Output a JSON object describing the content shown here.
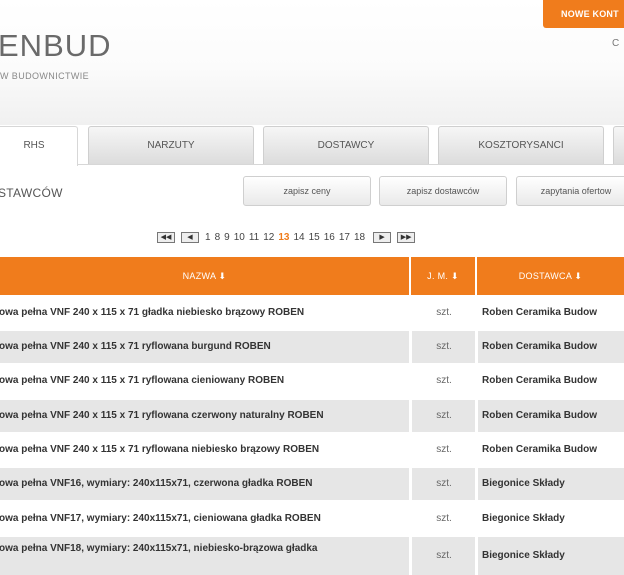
{
  "header": {
    "new_button": "NOWE KONT",
    "corner_text": "C",
    "logo_name": "ENBUD",
    "logo_sub": "W BUDOWNICTWIE"
  },
  "tabs": [
    {
      "label": "RHS",
      "active": true
    },
    {
      "label": "NARZUTY",
      "active": false
    },
    {
      "label": "DOSTAWCY",
      "active": false
    },
    {
      "label": "KOSZTORYSANCI",
      "active": false
    }
  ],
  "section": {
    "title": "STAWCÓW",
    "buttons": [
      "zapisz ceny",
      "zapisz dostawców",
      "zapytania ofertow"
    ]
  },
  "pagination": {
    "first_icon": "first-page-icon",
    "prev_icon": "prev-page-icon",
    "next_icon": "next-page-icon",
    "last_icon": "last-page-icon",
    "pages": [
      "1",
      "8",
      "9",
      "10",
      "11",
      "12",
      "13",
      "14",
      "15",
      "16",
      "17",
      "18"
    ],
    "current": "13"
  },
  "table": {
    "columns": [
      "NAZWA ⬇",
      "J. M. ⬇",
      "DOSTAWCA ⬇"
    ],
    "rows": [
      {
        "name": "owa pełna VNF 240 x 115 x 71 gładka niebiesko brązowy ROBEN",
        "unit": "szt.",
        "supplier": "Roben Ceramika Budow"
      },
      {
        "name": "owa pełna VNF 240 x 115 x 71 ryflowana burgund ROBEN",
        "unit": "szt.",
        "supplier": "Roben Ceramika Budow"
      },
      {
        "name": "owa pełna VNF 240 x 115 x 71 ryflowana cieniowany ROBEN",
        "unit": "szt.",
        "supplier": "Roben Ceramika Budow"
      },
      {
        "name": "owa pełna VNF 240 x 115 x 71 ryflowana czerwony naturalny ROBEN",
        "unit": "szt.",
        "supplier": "Roben Ceramika Budow"
      },
      {
        "name": "owa pełna VNF 240 x 115 x 71 ryflowana niebiesko brązowy ROBEN",
        "unit": "szt.",
        "supplier": "Roben Ceramika Budow"
      },
      {
        "name": "owa pełna VNF16, wymiary: 240x115x71, czerwona gładka ROBEN",
        "unit": "szt.",
        "supplier": "Biegonice Składy"
      },
      {
        "name": "owa pełna VNF17, wymiary: 240x115x71, cieniowana gładka ROBEN",
        "unit": "szt.",
        "supplier": "Biegonice Składy"
      },
      {
        "name": "owa pełna VNF18, wymiary: 240x115x71, niebiesko-brązowa gładka",
        "unit": "szt.",
        "supplier": "Biegonice Składy"
      }
    ]
  },
  "colors": {
    "accent": "#f07c1c",
    "row_alt": "#e6e6e6"
  }
}
